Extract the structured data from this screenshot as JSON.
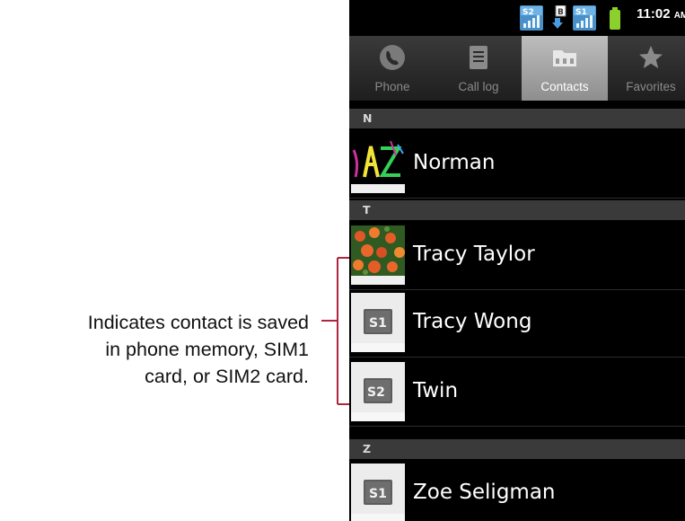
{
  "annotation": {
    "lines": [
      "Indicates contact is saved",
      "in phone memory, SIM1",
      "card, or SIM2 card."
    ]
  },
  "status_bar": {
    "time": "11:02",
    "ampm": "AM",
    "sim1_badge": "S1",
    "sim2_badge": "S2",
    "icons": [
      "sim2-signal-icon",
      "download-icon",
      "sim1-signal-icon",
      "battery-icon"
    ]
  },
  "tabs": [
    {
      "label": "Phone",
      "icon": "phone-icon",
      "selected": false
    },
    {
      "label": "Call log",
      "icon": "call-log-icon",
      "selected": false
    },
    {
      "label": "Contacts",
      "icon": "contacts-icon",
      "selected": true
    },
    {
      "label": "Favorites",
      "icon": "star-icon",
      "selected": false
    }
  ],
  "sections": [
    {
      "letter": "N"
    },
    {
      "letter": "T"
    },
    {
      "letter": "Z"
    }
  ],
  "contacts": [
    {
      "name": "Norman",
      "avatar": "photo-artwork"
    },
    {
      "name": "Tracy Taylor",
      "avatar": "photo-flowers"
    },
    {
      "name": "Tracy Wong",
      "avatar": "sim-card",
      "badge": "S1"
    },
    {
      "name": "Twin",
      "avatar": "sim-card",
      "badge": "S2"
    },
    {
      "name": "Zoe Seligman",
      "avatar": "sim-card",
      "badge": "S1"
    }
  ],
  "colors": {
    "bracket": "#b0263f",
    "section_bg": "#3a3a3a",
    "selected_tab": "#a8a8a8",
    "battery": "#8bd02c"
  }
}
